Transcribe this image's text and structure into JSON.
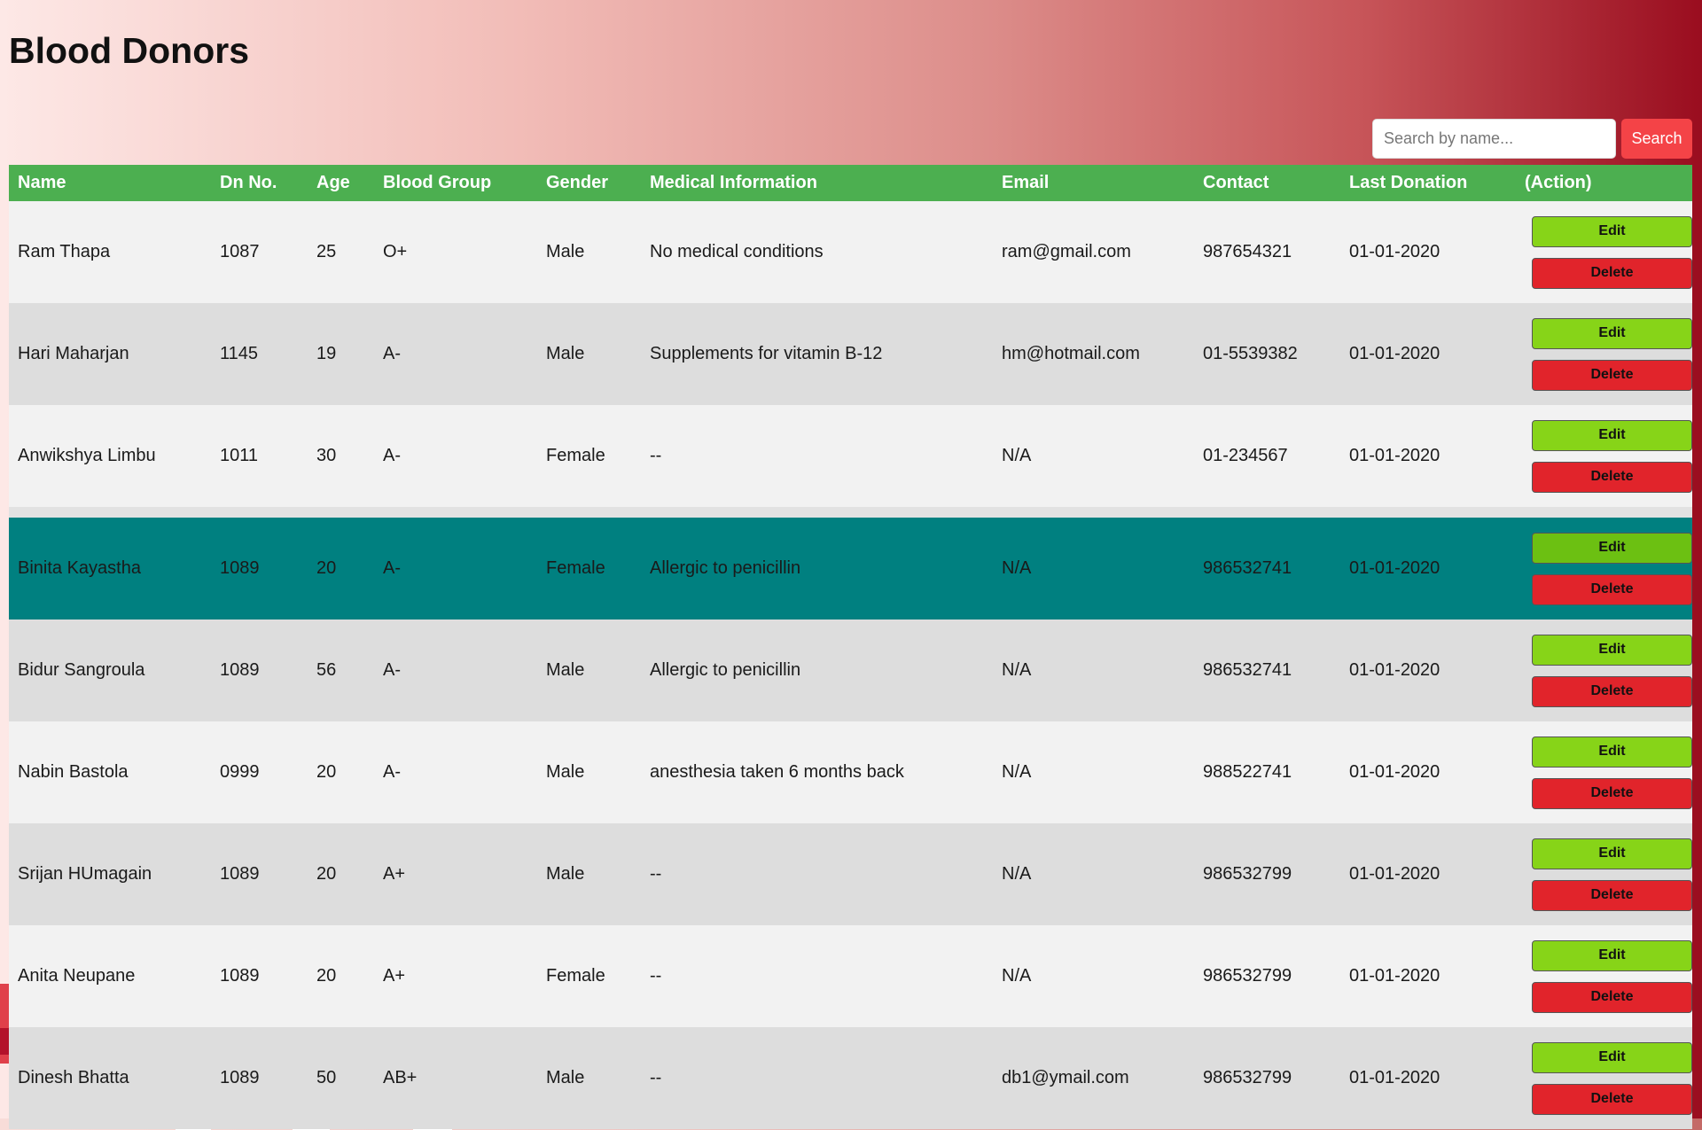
{
  "page": {
    "title": "Blood Donors"
  },
  "search": {
    "placeholder": "Search by name...",
    "button_label": "Search"
  },
  "table": {
    "columns": [
      "Name",
      "Dn No.",
      "Age",
      "Blood Group",
      "Gender",
      "Medical Information",
      "Email",
      "Contact",
      "Last Donation",
      "(Action)"
    ],
    "edit_label": "Edit",
    "delete_label": "Delete",
    "rows": [
      {
        "name": "Ram Thapa",
        "dn_no": "1087",
        "age": "25",
        "blood_group": "O+",
        "gender": "Male",
        "medical": "No medical conditions",
        "email": "ram@gmail.com",
        "contact": "987654321",
        "last_donation": "01-01-2020"
      },
      {
        "name": "Hari Maharjan",
        "dn_no": "1145",
        "age": "19",
        "blood_group": "A-",
        "gender": "Male",
        "medical": "Supplements for vitamin B-12",
        "email": "hm@hotmail.com",
        "contact": "01-5539382",
        "last_donation": "01-01-2020"
      },
      {
        "name": "Anwikshya Limbu",
        "dn_no": "1011",
        "age": "30",
        "blood_group": "A-",
        "gender": "Female",
        "medical": "--",
        "email": "N/A",
        "contact": "01-234567",
        "last_donation": "01-01-2020"
      },
      {
        "name": "Binita Kayastha",
        "dn_no": "1089",
        "age": "20",
        "blood_group": "A-",
        "gender": "Female",
        "medical": "Allergic to penicillin",
        "email": "N/A",
        "contact": "986532741",
        "last_donation": "01-01-2020"
      },
      {
        "name": "Bidur Sangroula",
        "dn_no": "1089",
        "age": "56",
        "blood_group": "A-",
        "gender": "Male",
        "medical": "Allergic to penicillin",
        "email": "N/A",
        "contact": "986532741",
        "last_donation": "01-01-2020"
      },
      {
        "name": "Nabin Bastola",
        "dn_no": "0999",
        "age": "20",
        "blood_group": "A-",
        "gender": "Male",
        "medical": "anesthesia taken 6 months back",
        "email": "N/A",
        "contact": "988522741",
        "last_donation": "01-01-2020"
      },
      {
        "name": "Srijan HUmagain",
        "dn_no": "1089",
        "age": "20",
        "blood_group": "A+",
        "gender": "Male",
        "medical": "--",
        "email": "N/A",
        "contact": "986532799",
        "last_donation": "01-01-2020"
      },
      {
        "name": "Anita Neupane",
        "dn_no": "1089",
        "age": "20",
        "blood_group": "A+",
        "gender": "Female",
        "medical": "--",
        "email": "N/A",
        "contact": "986532799",
        "last_donation": "01-01-2020"
      },
      {
        "name": "Dinesh Bhatta",
        "dn_no": "1089",
        "age": "50",
        "blood_group": "AB+",
        "gender": "Male",
        "medical": "--",
        "email": "db1@ymail.com",
        "contact": "986532799",
        "last_donation": "01-01-2020"
      }
    ]
  },
  "colors": {
    "header_bg": "#4caf50",
    "highlight_row_bg": "#008080",
    "edit_button_bg": "#87d418",
    "delete_button_bg": "#e1242b",
    "search_button_bg": "#f44347"
  }
}
